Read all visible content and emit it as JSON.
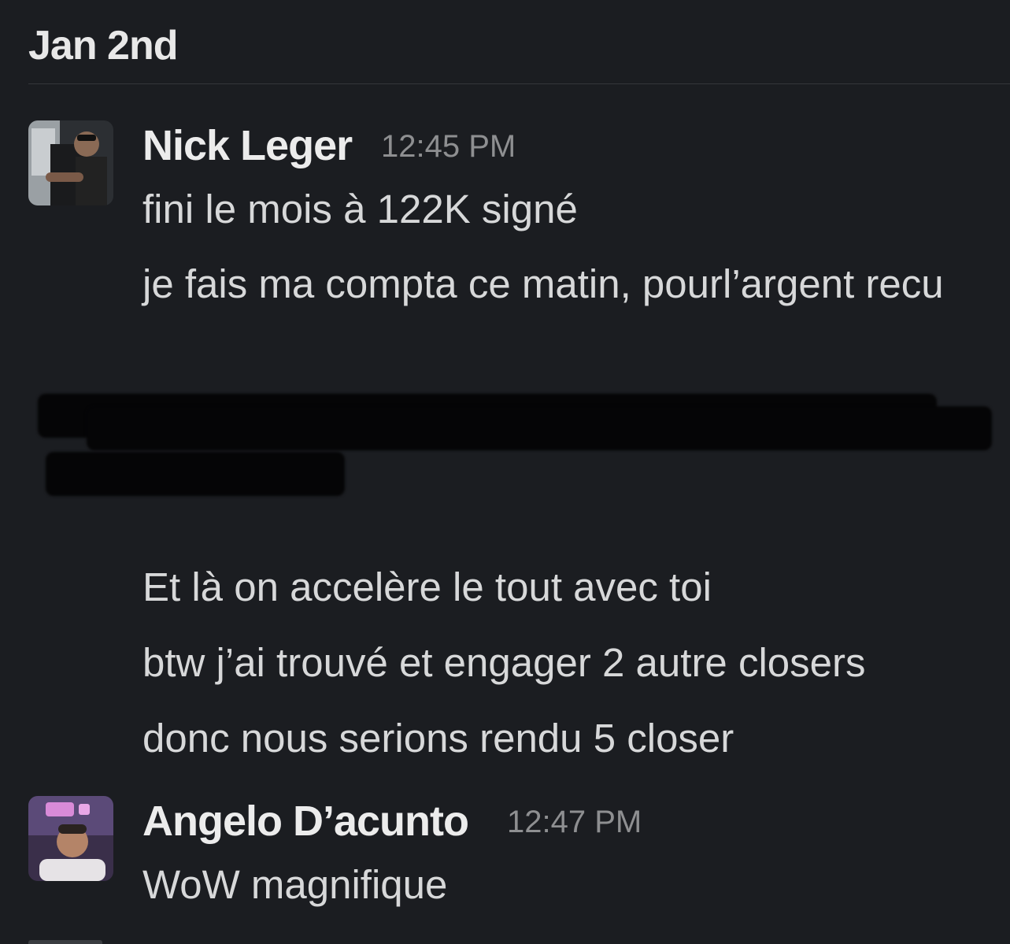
{
  "conversation": {
    "date_header": "Jan 2nd",
    "messages": [
      {
        "sender": "Nick Leger",
        "time": "12:45 PM",
        "avatar": "user-photo-icon",
        "lines": [
          "fini le mois à 122K signé",
          "je fais ma compta ce matin, pourl’argent recu",
          "Et là on accelère le tout avec toi",
          "btw j’ai trouvé et engager 2 autre closers",
          "donc nous serions rendu 5 closer"
        ]
      },
      {
        "sender": "Angelo D’acunto",
        "time": "12:47 PM",
        "avatar": "user-photo-icon",
        "lines": [
          "WoW magnifique"
        ]
      }
    ]
  },
  "colors": {
    "background": "#1b1d21",
    "text": "#d7d8d9",
    "sender": "#ececec",
    "timestamp": "#8e8f91",
    "redaction": "#050506"
  }
}
